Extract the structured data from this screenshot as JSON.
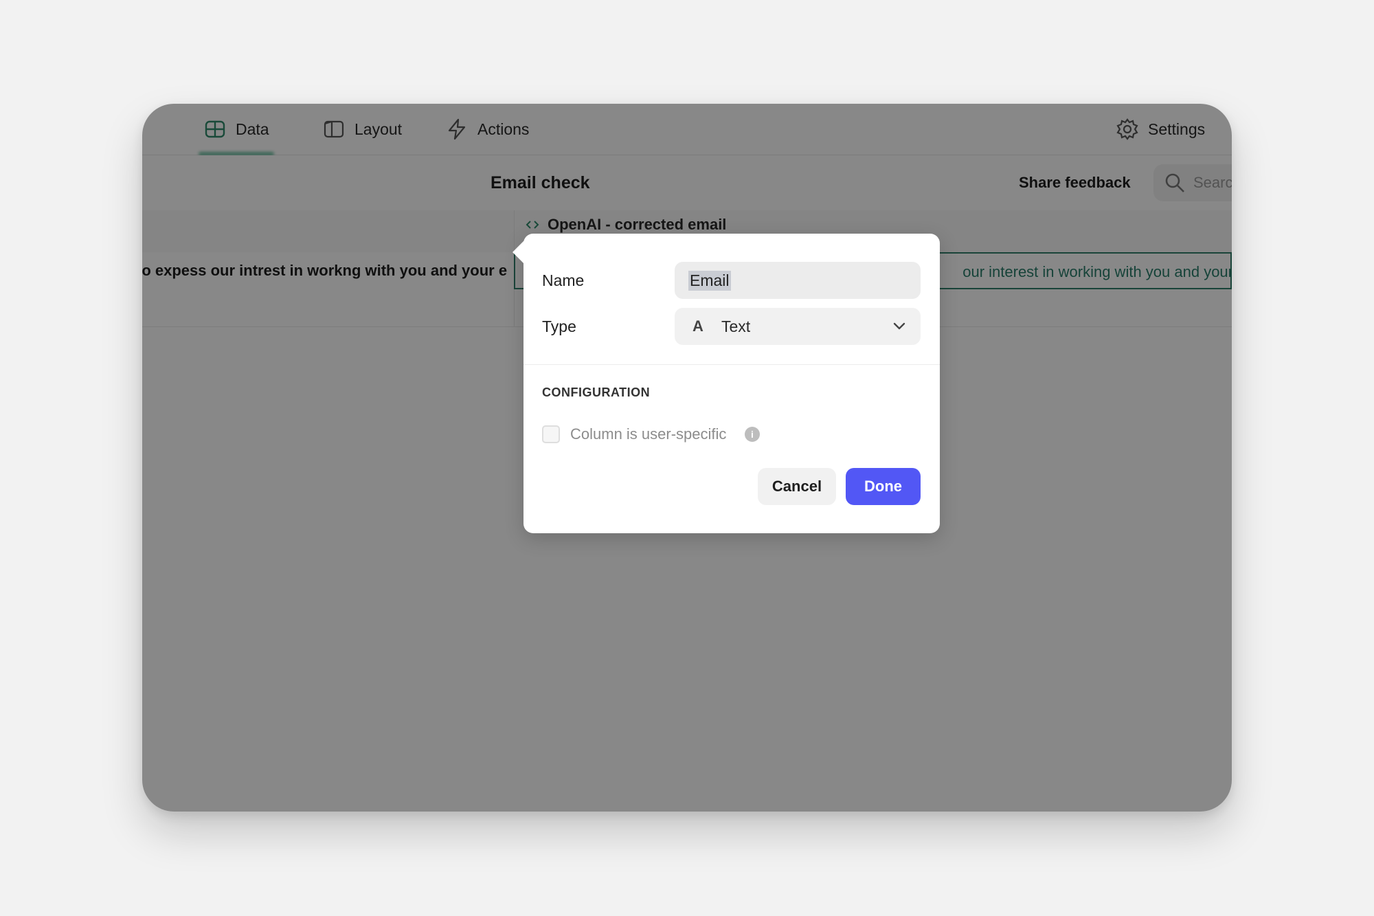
{
  "nav": {
    "data_label": "Data",
    "layout_label": "Layout",
    "actions_label": "Actions",
    "settings_label": "Settings"
  },
  "header": {
    "title": "Email check",
    "share_label": "Share feedback",
    "search_placeholder": "Search"
  },
  "grid": {
    "column_right_header": "OpenAI - corrected email",
    "row1_left": "to expess our intrest in workng with you and your e",
    "row1_right": "our interest in working with you and your"
  },
  "popover": {
    "name_label": "Name",
    "name_value": "Email",
    "type_label": "Type",
    "type_icon_glyph": "A",
    "type_value": "Text",
    "section_title": "CONFIGURATION",
    "checkbox_label": "Column is user-specific",
    "cancel_label": "Cancel",
    "done_label": "Done"
  },
  "colors": {
    "accent": "#5257f5",
    "active_tab": "#36a57b",
    "cell_text": "#2a7d6a"
  }
}
